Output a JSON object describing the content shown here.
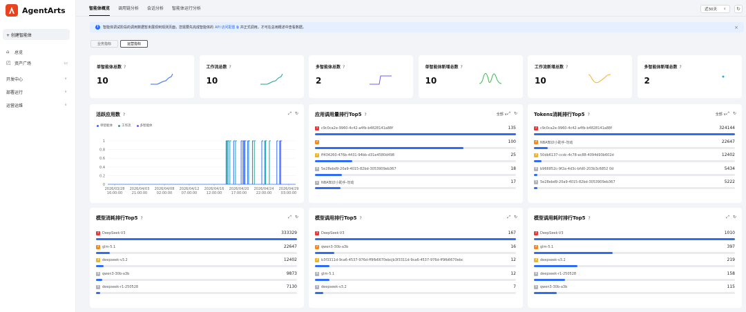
{
  "app": {
    "name": "AgentArts"
  },
  "sidebar": {
    "create": "+ 创建智能体",
    "items": [
      {
        "icon": "⌂",
        "label": "总览"
      },
      {
        "icon": "◰",
        "label": "资产广场"
      },
      {
        "label": "开发中心"
      },
      {
        "label": "部署运行"
      },
      {
        "label": "运营运维"
      }
    ]
  },
  "header": {
    "tabs": [
      "智能体概览",
      "调用链分析",
      "会话分析",
      "智能体运行分析"
    ],
    "range": "近30天",
    "range_chevron": "∨",
    "refresh_icon": "↻"
  },
  "notice": {
    "icon": "i",
    "text_before": "智能体调试阶段的调用数据暂未展现到观测页面，您需要先完成智能体的",
    "link": "API 访问配置 ⧉",
    "text_after": "并正式调用，才可在总用概述中查看数据。",
    "close": "×"
  },
  "subtabs": [
    "业务指标",
    "运营指标"
  ],
  "kpis": [
    {
      "label": "单智能体总数",
      "value": "10",
      "color": "#2f6cf6"
    },
    {
      "label": "工作流总数",
      "value": "10",
      "color": "#11a89a"
    },
    {
      "label": "多智能体总数",
      "value": "2",
      "color": "#6b5cf0"
    },
    {
      "label": "单智能体新增总数",
      "value": "10",
      "color": "#35b84c"
    },
    {
      "label": "工作流新增总数",
      "value": "10",
      "color": "#f0b428"
    },
    {
      "label": "多智能体新增总数",
      "value": "2",
      "color": "#2aa8e0"
    }
  ],
  "help_icon": "?",
  "expand_icon": "⤢",
  "panel_refresh_icon": "↻",
  "active_chart": {
    "title": "活跃应用数",
    "legend": [
      "单智能体",
      "工作流",
      "多智能体"
    ],
    "legend_colors": [
      "#2f6cf6",
      "#11a89a",
      "#6b5cf0"
    ],
    "yticks": [
      "1",
      "0.8",
      "0.6",
      "0.4",
      "0.2",
      "0"
    ],
    "xticks": [
      [
        "2026/03/28",
        "16:00:00"
      ],
      [
        "2026/04/03",
        "21:00:00"
      ],
      [
        "2026/04/08",
        "02:00:00"
      ],
      [
        "2026/04/12",
        "07:00:00"
      ],
      [
        "2026/04/16",
        "12:00:00"
      ],
      [
        "2026/04/20",
        "17:00:00"
      ],
      [
        "2026/04/24",
        "22:00:00"
      ],
      [
        "2026/04/29",
        "03:00:00"
      ]
    ]
  },
  "chart_data": {
    "type": "bar",
    "title": "活跃应用数",
    "ylim": [
      0,
      1
    ],
    "series": [
      {
        "name": "单智能体",
        "spikes": [
          0.63,
          0.64,
          0.67,
          0.71,
          0.725,
          0.73,
          0.745,
          0.77,
          0.82,
          0.835,
          0.9,
          0.915
        ]
      },
      {
        "name": "工作流",
        "spikes": [
          0.635,
          0.65,
          0.68,
          0.72,
          0.75,
          0.78,
          0.84,
          0.86,
          0.92
        ]
      },
      {
        "name": "多智能体",
        "spikes": [
          0.72,
          0.92
        ]
      }
    ]
  },
  "panels": [
    {
      "title": "应用调用量排行Top5",
      "filter": "全部 ∨",
      "rows": [
        {
          "rank": "1",
          "label": "c9c0ca2e-9960-4c42-a4fb-b4828141a88f",
          "value": "135",
          "ratio": 1
        },
        {
          "rank": "2",
          "label": "",
          "value": "100",
          "ratio": 0.74
        },
        {
          "rank": "3",
          "label": "ff434260-476b-4431-94bb-d31e4580d498",
          "value": "25",
          "ratio": 0.185
        },
        {
          "rank": "4",
          "label": "5e28ebd9-20a9-4015-82bd-3053909eb367",
          "value": "18",
          "ratio": 0.133
        },
        {
          "rank": "5",
          "label": "NBA知识小助手-勿动",
          "value": "17",
          "ratio": 0.126
        }
      ]
    },
    {
      "title": "Tokens消耗排行Top5",
      "filter": "全部 ∨",
      "rows": [
        {
          "rank": "1",
          "label": "c9c0ca2e-9960-4c42-a4fb-b4828141a88f",
          "value": "324144",
          "ratio": 1
        },
        {
          "rank": "2",
          "label": "NBA知识小助手-勿动",
          "value": "22647",
          "ratio": 0.07
        },
        {
          "rank": "3",
          "label": "50db6137-ccdc-4c78-ac88-4094d93b602d",
          "value": "12402",
          "ratio": 0.038
        },
        {
          "rank": "4",
          "label": "b966852c-9f2a-4d3c-bfd0-203b3c6852 0d",
          "value": "5434",
          "ratio": 0.017
        },
        {
          "rank": "5",
          "label": "5e28ebd9-20a9-4015-82bd-3053909eb367",
          "value": "5222",
          "ratio": 0.016
        }
      ]
    },
    {
      "title": "模型消耗排行Top5",
      "filter": "",
      "rows": [
        {
          "rank": "1",
          "label": "DeepSeek-V3",
          "value": "333329",
          "ratio": 1
        },
        {
          "rank": "2",
          "label": "glm-5.1",
          "value": "22647",
          "ratio": 0.068
        },
        {
          "rank": "3",
          "label": "deepseek-v3.2",
          "value": "12402",
          "ratio": 0.037
        },
        {
          "rank": "4",
          "label": "qwen3-30b-a3b",
          "value": "9873",
          "ratio": 0.03
        },
        {
          "rank": "5",
          "label": "deepseek-r1-250528",
          "value": "7130",
          "ratio": 0.021
        }
      ]
    },
    {
      "title": "模型调用排行Top5",
      "filter": "",
      "rows": [
        {
          "rank": "1",
          "label": "DeepSeek-V3",
          "value": "167",
          "ratio": 1
        },
        {
          "rank": "2",
          "label": "qwen3-30b-a3b",
          "value": "16",
          "ratio": 0.096
        },
        {
          "rank": "3",
          "label": "b3f3311d-9ca6-4537-976d-ff9fb6670ebcjb3f3311d-9ca6-4537-976d-ff9fb6670ebc",
          "value": "12",
          "ratio": 0.072
        },
        {
          "rank": "4",
          "label": "glm-5.1",
          "value": "12",
          "ratio": 0.072
        },
        {
          "rank": "5",
          "label": "deepseek-v3.2",
          "value": "7",
          "ratio": 0.042
        }
      ]
    },
    {
      "title": "模型调用耗时排行Top5",
      "filter": "",
      "rows": [
        {
          "rank": "1",
          "label": "DeepSeek-V3",
          "value": "1010",
          "ratio": 1
        },
        {
          "rank": "2",
          "label": "glm-5.1",
          "value": "397",
          "ratio": 0.393
        },
        {
          "rank": "3",
          "label": "deepseek-v3.2",
          "value": "219",
          "ratio": 0.217
        },
        {
          "rank": "4",
          "label": "deepseek-r1-250528",
          "value": "158",
          "ratio": 0.156
        },
        {
          "rank": "5",
          "label": "qwen3-30b-a3b",
          "value": "115",
          "ratio": 0.114
        }
      ]
    }
  ],
  "rank_colors": [
    "#e23b3b",
    "#f08a24",
    "#f0b428",
    "#b0b4bb",
    "#b0b4bb"
  ]
}
